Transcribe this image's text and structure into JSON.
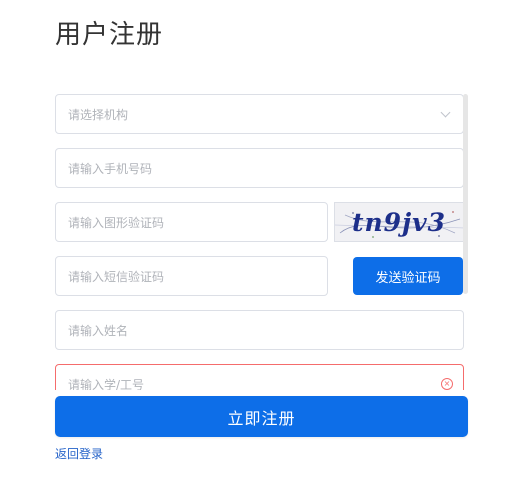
{
  "page": {
    "title": "用户注册"
  },
  "form": {
    "org_placeholder": "请选择机构",
    "phone_placeholder": "请输入手机号码",
    "captcha_placeholder": "请输入图形验证码",
    "captcha_text": "tn9jv3",
    "sms_placeholder": "请输入短信验证码",
    "send_code_label": "发送验证码",
    "name_placeholder": "请输入姓名",
    "student_id_placeholder": "请输入学/工号",
    "error_icon_glyph": "×",
    "chevron_icon": "chevron-down-icon"
  },
  "actions": {
    "submit_label": "立即注册",
    "back_login_label": "返回登录"
  },
  "colors": {
    "primary": "#0d6ee8",
    "error": "#f56c6c",
    "link": "#2563c9"
  }
}
